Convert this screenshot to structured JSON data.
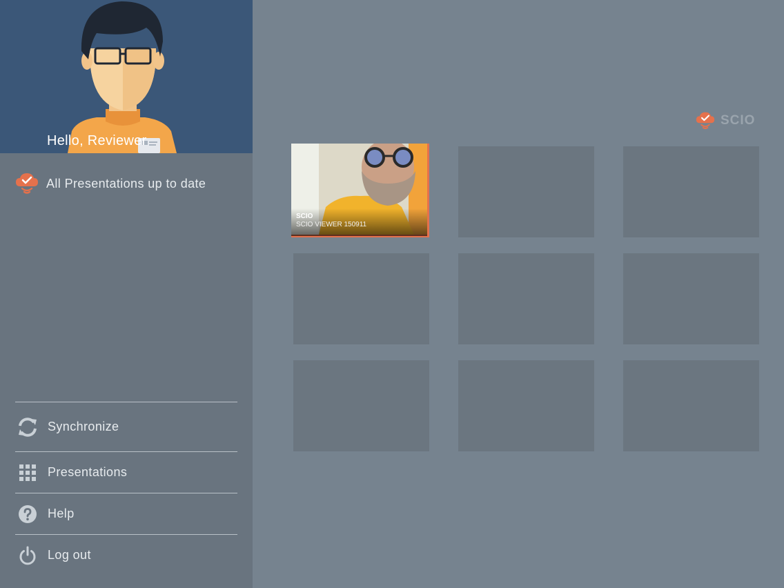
{
  "profile": {
    "greeting": "Hello, Reviewer"
  },
  "status": {
    "text": "All Presentations up to date",
    "icon": "cloud-check-icon"
  },
  "menu": {
    "items": [
      {
        "label": "Synchronize",
        "icon": "sync-icon"
      },
      {
        "label": "Presentations",
        "icon": "grid-icon"
      },
      {
        "label": "Help",
        "icon": "help-icon"
      },
      {
        "label": "Log out",
        "icon": "power-icon"
      }
    ]
  },
  "brand": {
    "name": "SCIO"
  },
  "presentations": [
    {
      "title": "SCIO",
      "subtitle": "SCIO VIEWER 150911"
    }
  ],
  "colors": {
    "accent": "#e5714c",
    "sidebar": "#69747f",
    "profile_bg": "#3b5778",
    "main_bg": "#76838f",
    "tile_placeholder": "#6b7680"
  }
}
